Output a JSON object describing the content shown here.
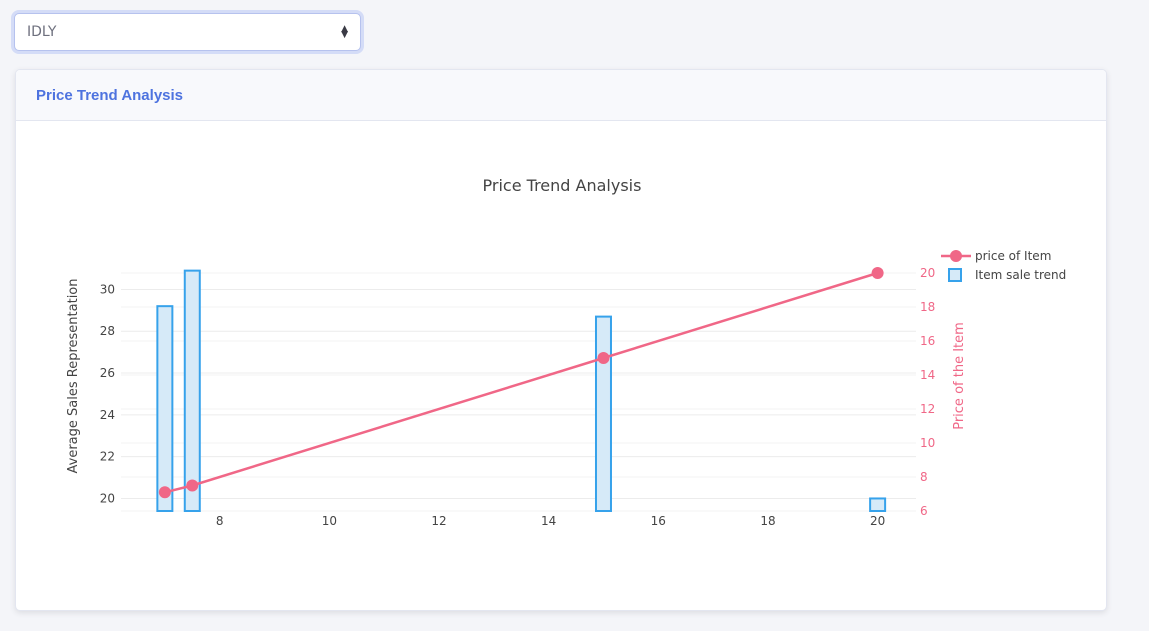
{
  "selector": {
    "value": "IDLY"
  },
  "card": {
    "title": "Price Trend Analysis"
  },
  "chart_data": {
    "type": "bar+line",
    "title": "Price Trend Analysis",
    "xlabel": "",
    "ylabel": "Average Sales Representation",
    "y2label": "Price of the Item",
    "xlim": [
      6.2,
      20.7
    ],
    "ylim": [
      19.4,
      31.6
    ],
    "y2lim": [
      6,
      21
    ],
    "x_ticks": [
      8,
      10,
      12,
      14,
      16,
      18,
      20
    ],
    "y_ticks": [
      20,
      22,
      24,
      26,
      28,
      30
    ],
    "y2_ticks": [
      6,
      8,
      10,
      12,
      14,
      16,
      18,
      20
    ],
    "grid": true,
    "legend_position": "top-right",
    "bar_series": {
      "name": "Item sale trend",
      "color": "#36a2eb",
      "x": [
        7,
        7.5,
        15,
        20
      ],
      "values": [
        29.2,
        30.9,
        28.7,
        20
      ]
    },
    "line_series": {
      "name": "price of Item",
      "color": "#f06787",
      "x": [
        7,
        7.5,
        15,
        20
      ],
      "values": [
        7.1,
        7.5,
        15,
        20
      ]
    }
  }
}
